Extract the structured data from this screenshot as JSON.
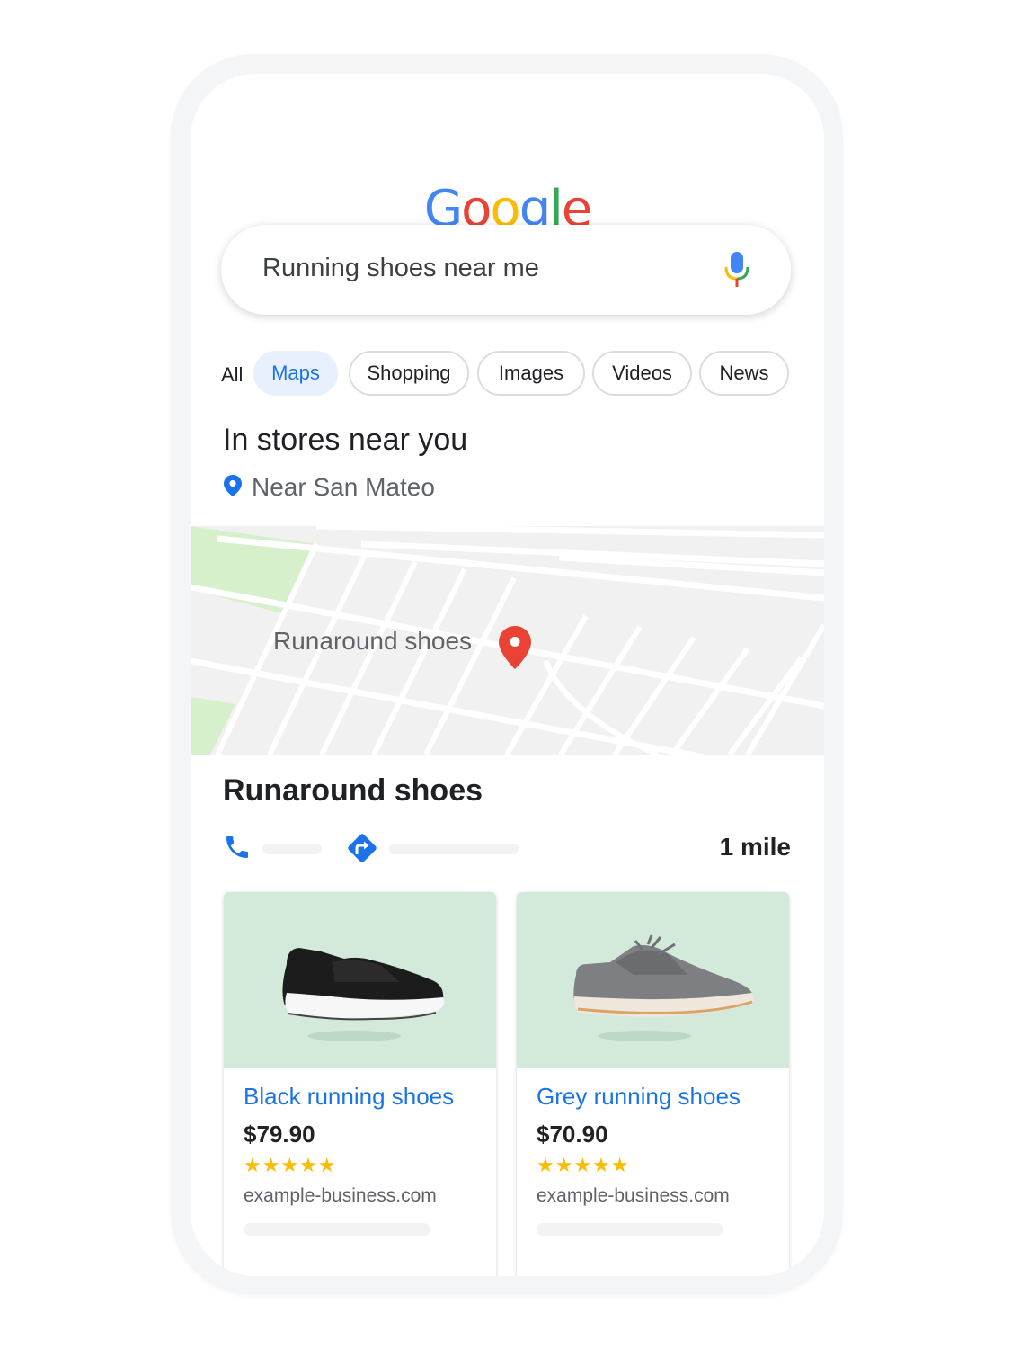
{
  "logo": {
    "letters": [
      "G",
      "o",
      "o",
      "g",
      "l",
      "e"
    ],
    "colors": [
      "#4285F4",
      "#EA4335",
      "#FBBC05",
      "#4285F4",
      "#34A853",
      "#EA4335"
    ]
  },
  "search": {
    "query": "Running shoes near me"
  },
  "tabs": [
    {
      "label": "All",
      "active": false
    },
    {
      "label": "Maps",
      "active": true
    },
    {
      "label": "Shopping",
      "active": false
    },
    {
      "label": "Images",
      "active": false
    },
    {
      "label": "Videos",
      "active": false
    },
    {
      "label": "News",
      "active": false
    }
  ],
  "section": {
    "title": "In stores near you",
    "location": "Near San Mateo"
  },
  "map": {
    "label": "Runaround shoes"
  },
  "store": {
    "name": "Runaround shoes",
    "distance": "1 mile"
  },
  "products": [
    {
      "name": "Black running shoes",
      "price": "$79.90",
      "rating_stars": "★★★★★",
      "rating": 4.5,
      "site": "example-business.com"
    },
    {
      "name": "Grey running shoes",
      "price": "$70.90",
      "rating_stars": "★★★★★",
      "rating": 4.5,
      "site": "example-business.com"
    }
  ],
  "colors": {
    "accent": "#1a73e8",
    "map_pin": "#EA4335",
    "chip_active_bg": "#e8f0fe",
    "card_image_bg": "#d3eadb",
    "star": "#fbbc04"
  }
}
